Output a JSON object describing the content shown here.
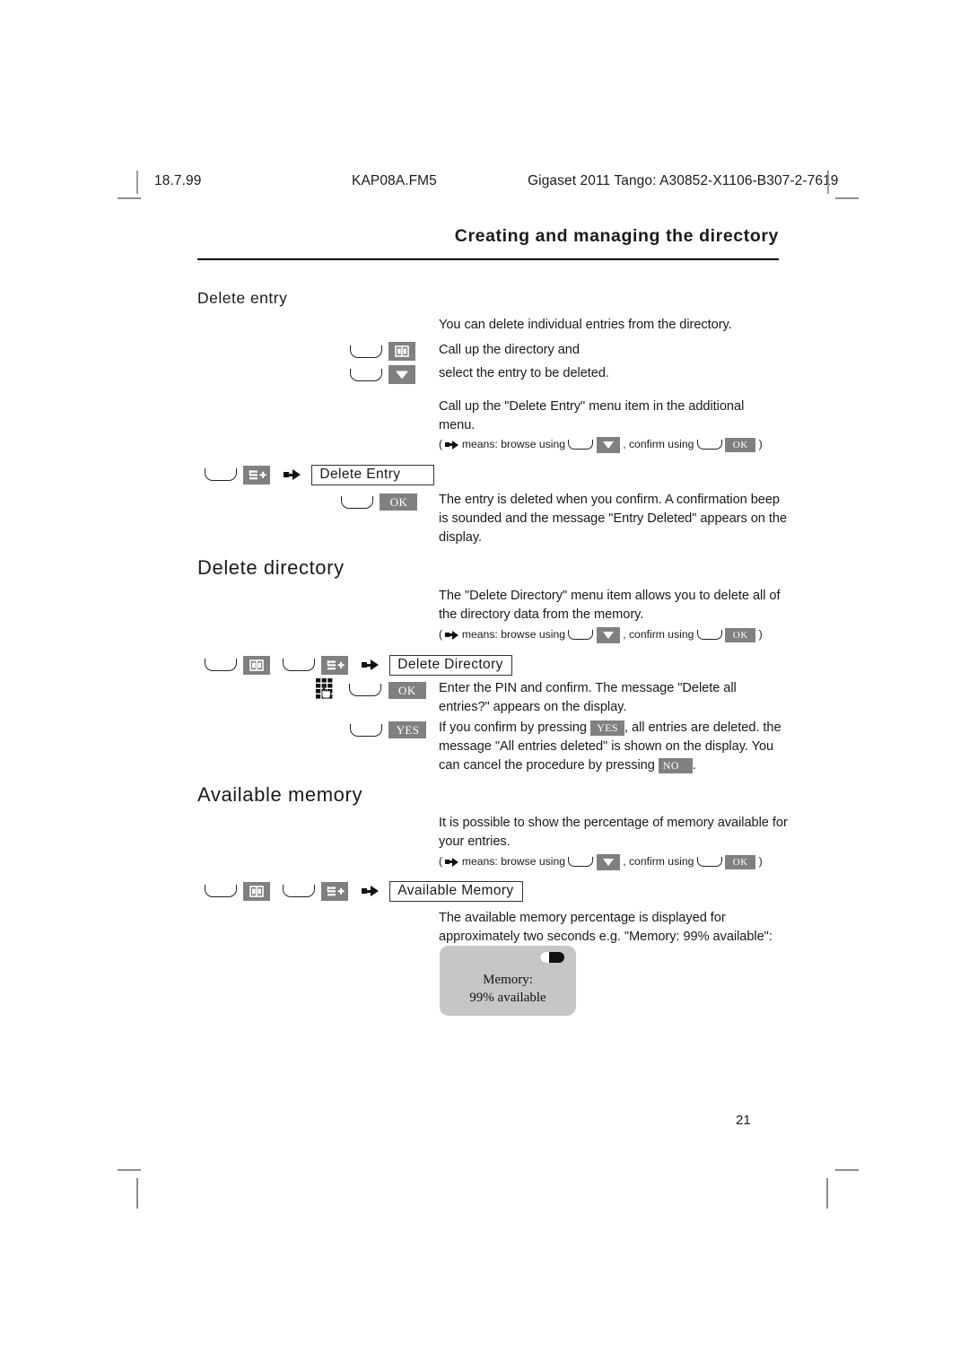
{
  "running_head": {
    "date": "18.7.99",
    "file": "KAP08A.FM5",
    "product": "Gigaset 2011 Tango: A30852-X1106-B307-2-7619"
  },
  "chapter_title": "Creating and managing the directory",
  "sections": {
    "delete_entry": {
      "heading": "Delete entry",
      "intro": "You can delete individual entries from the directory.",
      "step1_text": "Call up the directory and",
      "step2_text": "select the entry to be deleted.",
      "step3_text": "Call up the \"Delete Entry\" menu item in the additional menu.",
      "note_prefix": "(",
      "note_means": "means: browse using",
      "note_confirm": ", confirm using",
      "note_suffix": ")",
      "menu_item": "Delete Entry",
      "confirm_text": "The entry is deleted when you confirm. A confirmation beep is sounded and the message \"Entry Deleted\" appears on the display."
    },
    "delete_directory": {
      "heading": "Delete directory",
      "intro": "The \"Delete Directory\" menu item allows you to delete all of the directory data from the memory.",
      "menu_item": "Delete Directory",
      "pin_text": "Enter the PIN and confirm. The message \"Delete all entries?\" appears on the display.",
      "yes_text_a": "If you confirm by pressing",
      "yes_text_b": ", all entries are deleted. the message \"All entries deleted\" is shown on the display. You can cancel the procedure by pressing",
      "yes_text_c": "."
    },
    "available_memory": {
      "heading": "Available memory",
      "intro": "It is possible to show the percentage of memory available for your entries.",
      "menu_item": "Available Memory",
      "result_text": "The available memory percentage is displayed for approximately two seconds e.g. \"Memory: 99% available\":"
    }
  },
  "handset_display": {
    "line1": "Memory:",
    "line2": "99% available",
    "battery_icon": "battery-icon"
  },
  "keys": {
    "ok_label": "OK",
    "yes_label": "YES",
    "no_label": "NO",
    "directory_icon": "book-icon",
    "menu_icon": "menu-plus-icon",
    "down_icon": "down-arrow-icon",
    "keypad_icon": "keypad-icon",
    "softkey_icon": "soft-key"
  },
  "page_number": "21",
  "colors": {
    "key_gray": "#808080",
    "display_gray": "#c6c6c6",
    "text": "#1a1a1a"
  }
}
